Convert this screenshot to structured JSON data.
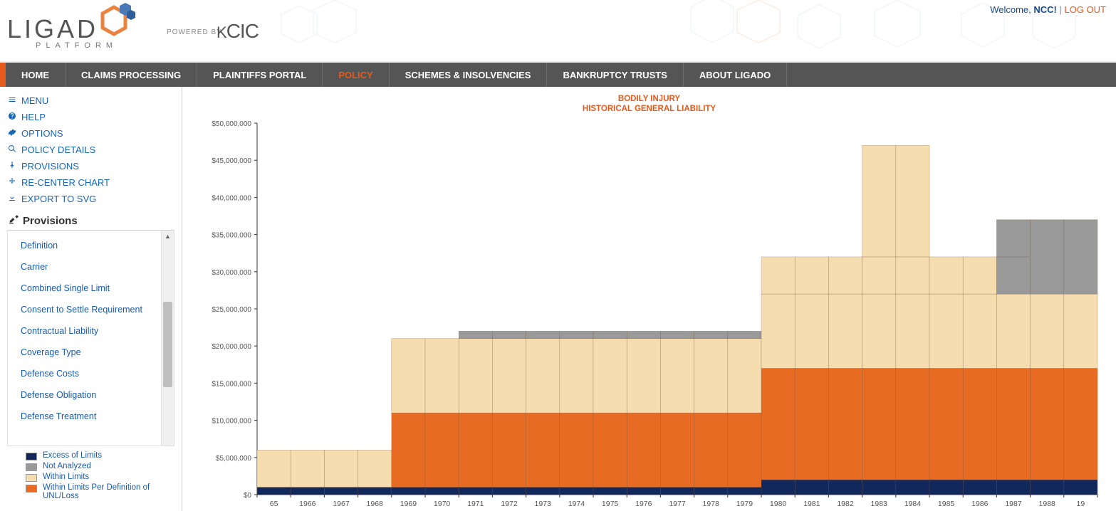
{
  "header": {
    "brand_main": "LIGAD",
    "brand_sub": "PLATFORM",
    "powered_by": "POWERED BY",
    "powered_brand": "KCIC",
    "welcome_prefix": "Welcome, ",
    "welcome_user": "NCC!",
    "logout": "LOG OUT"
  },
  "nav": {
    "items": [
      {
        "label": "HOME",
        "active": false
      },
      {
        "label": "CLAIMS PROCESSING",
        "active": false
      },
      {
        "label": "PLAINTIFFS PORTAL",
        "active": false
      },
      {
        "label": "POLICY",
        "active": true
      },
      {
        "label": "SCHEMES & INSOLVENCIES",
        "active": false
      },
      {
        "label": "BANKRUPTCY TRUSTS",
        "active": false
      },
      {
        "label": "ABOUT LIGADO",
        "active": false
      }
    ]
  },
  "sidebar": {
    "tools": [
      {
        "icon": "menu",
        "label": "MENU"
      },
      {
        "icon": "help",
        "label": "HELP"
      },
      {
        "icon": "options",
        "label": "OPTIONS"
      },
      {
        "icon": "search",
        "label": "POLICY DETAILS"
      },
      {
        "icon": "pin",
        "label": "PROVISIONS"
      },
      {
        "icon": "move",
        "label": "RE-CENTER CHART"
      },
      {
        "icon": "download",
        "label": "EXPORT TO SVG"
      }
    ],
    "panel_title": "Provisions",
    "provisions": [
      "Definition",
      "Carrier",
      "Combined Single Limit",
      "Consent to Settle Requirement",
      "Contractual Liability",
      "Coverage Type",
      "Defense Costs",
      "Defense Obligation",
      "Defense Treatment"
    ],
    "legend": [
      {
        "color": "#12275c",
        "label": "Excess of Limits"
      },
      {
        "color": "#9a9a9a",
        "label": "Not Analyzed"
      },
      {
        "color": "#f6ddb0",
        "label": "Within Limits"
      },
      {
        "color": "#e86b24",
        "label": "Within Limits Per Definition of UNL/Loss"
      }
    ]
  },
  "chart": {
    "title_line1": "BODILY INJURY",
    "title_line2": "HISTORICAL GENERAL LIABILITY"
  },
  "chart_data": {
    "type": "bar",
    "xlabel": "",
    "ylabel": "",
    "ylim": [
      0,
      50000000
    ],
    "yticks": [
      0,
      5000000,
      10000000,
      15000000,
      20000000,
      25000000,
      30000000,
      35000000,
      40000000,
      45000000,
      50000000
    ],
    "ytick_labels": [
      "$0",
      "$5,000,000",
      "$10,000,000",
      "$15,000,000",
      "$20,000,000",
      "$25,000,000",
      "$30,000,000",
      "$35,000,000",
      "$40,000,000",
      "$45,000,000",
      "$50,000,000"
    ],
    "categories": [
      "65",
      "1966",
      "1967",
      "1968",
      "1969",
      "1970",
      "1971",
      "1972",
      "1973",
      "1974",
      "1975",
      "1976",
      "1977",
      "1978",
      "1979",
      "1980",
      "1981",
      "1982",
      "1983",
      "1984",
      "1985",
      "1986",
      "1987",
      "1988",
      "19"
    ],
    "series_colors": {
      "excess_of_limits": "#12275c",
      "within_limits_per_def": "#e86b24",
      "within_limits": "#f6ddb0",
      "not_analyzed": "#9a9a9a"
    },
    "stacks": [
      {
        "year": "65",
        "segments": [
          {
            "s": "excess_of_limits",
            "v": 1000000
          },
          {
            "s": "within_limits",
            "v": 5000000
          }
        ]
      },
      {
        "year": "1966",
        "segments": [
          {
            "s": "excess_of_limits",
            "v": 1000000
          },
          {
            "s": "within_limits",
            "v": 5000000
          }
        ]
      },
      {
        "year": "1967",
        "segments": [
          {
            "s": "excess_of_limits",
            "v": 1000000
          },
          {
            "s": "within_limits",
            "v": 5000000
          }
        ]
      },
      {
        "year": "1968",
        "segments": [
          {
            "s": "excess_of_limits",
            "v": 1000000
          },
          {
            "s": "within_limits",
            "v": 5000000
          }
        ]
      },
      {
        "year": "1969",
        "segments": [
          {
            "s": "excess_of_limits",
            "v": 1000000
          },
          {
            "s": "within_limits_per_def",
            "v": 10000000
          },
          {
            "s": "within_limits",
            "v": 10000000
          }
        ]
      },
      {
        "year": "1970",
        "segments": [
          {
            "s": "excess_of_limits",
            "v": 1000000
          },
          {
            "s": "within_limits_per_def",
            "v": 10000000
          },
          {
            "s": "within_limits",
            "v": 10000000
          }
        ]
      },
      {
        "year": "1971",
        "segments": [
          {
            "s": "excess_of_limits",
            "v": 1000000
          },
          {
            "s": "within_limits_per_def",
            "v": 10000000
          },
          {
            "s": "within_limits",
            "v": 10000000
          },
          {
            "s": "not_analyzed",
            "v": 1000000
          }
        ]
      },
      {
        "year": "1972",
        "segments": [
          {
            "s": "excess_of_limits",
            "v": 1000000
          },
          {
            "s": "within_limits_per_def",
            "v": 10000000
          },
          {
            "s": "within_limits",
            "v": 10000000
          },
          {
            "s": "not_analyzed",
            "v": 1000000
          }
        ]
      },
      {
        "year": "1973",
        "segments": [
          {
            "s": "excess_of_limits",
            "v": 1000000
          },
          {
            "s": "within_limits_per_def",
            "v": 10000000
          },
          {
            "s": "within_limits",
            "v": 10000000
          },
          {
            "s": "not_analyzed",
            "v": 1000000
          }
        ]
      },
      {
        "year": "1974",
        "segments": [
          {
            "s": "excess_of_limits",
            "v": 1000000
          },
          {
            "s": "within_limits_per_def",
            "v": 10000000
          },
          {
            "s": "within_limits",
            "v": 10000000
          },
          {
            "s": "not_analyzed",
            "v": 1000000
          }
        ]
      },
      {
        "year": "1975",
        "segments": [
          {
            "s": "excess_of_limits",
            "v": 1000000
          },
          {
            "s": "within_limits_per_def",
            "v": 10000000
          },
          {
            "s": "within_limits",
            "v": 10000000
          },
          {
            "s": "not_analyzed",
            "v": 1000000
          }
        ]
      },
      {
        "year": "1976",
        "segments": [
          {
            "s": "excess_of_limits",
            "v": 1000000
          },
          {
            "s": "within_limits_per_def",
            "v": 10000000
          },
          {
            "s": "within_limits",
            "v": 10000000
          },
          {
            "s": "not_analyzed",
            "v": 1000000
          }
        ]
      },
      {
        "year": "1977",
        "segments": [
          {
            "s": "excess_of_limits",
            "v": 1000000
          },
          {
            "s": "within_limits_per_def",
            "v": 10000000
          },
          {
            "s": "within_limits",
            "v": 10000000
          },
          {
            "s": "not_analyzed",
            "v": 1000000
          }
        ]
      },
      {
        "year": "1978",
        "segments": [
          {
            "s": "excess_of_limits",
            "v": 1000000
          },
          {
            "s": "within_limits_per_def",
            "v": 10000000
          },
          {
            "s": "within_limits",
            "v": 10000000
          },
          {
            "s": "not_analyzed",
            "v": 1000000
          }
        ]
      },
      {
        "year": "1979",
        "segments": [
          {
            "s": "excess_of_limits",
            "v": 1000000
          },
          {
            "s": "within_limits_per_def",
            "v": 10000000
          },
          {
            "s": "within_limits",
            "v": 10000000
          },
          {
            "s": "not_analyzed",
            "v": 1000000
          }
        ]
      },
      {
        "year": "1980",
        "segments": [
          {
            "s": "excess_of_limits",
            "v": 2000000
          },
          {
            "s": "within_limits_per_def",
            "v": 15000000
          },
          {
            "s": "within_limits",
            "v": 10000000
          },
          {
            "s": "within_limits",
            "v": 5000000
          }
        ]
      },
      {
        "year": "1981",
        "segments": [
          {
            "s": "excess_of_limits",
            "v": 2000000
          },
          {
            "s": "within_limits_per_def",
            "v": 15000000
          },
          {
            "s": "within_limits",
            "v": 10000000
          },
          {
            "s": "within_limits",
            "v": 5000000
          }
        ]
      },
      {
        "year": "1982",
        "segments": [
          {
            "s": "excess_of_limits",
            "v": 2000000
          },
          {
            "s": "within_limits_per_def",
            "v": 15000000
          },
          {
            "s": "within_limits",
            "v": 10000000
          },
          {
            "s": "within_limits",
            "v": 5000000
          }
        ]
      },
      {
        "year": "1983",
        "segments": [
          {
            "s": "excess_of_limits",
            "v": 2000000
          },
          {
            "s": "within_limits_per_def",
            "v": 15000000
          },
          {
            "s": "within_limits",
            "v": 10000000
          },
          {
            "s": "within_limits",
            "v": 5000000
          },
          {
            "s": "within_limits",
            "v": 15000000
          }
        ]
      },
      {
        "year": "1984",
        "segments": [
          {
            "s": "excess_of_limits",
            "v": 2000000
          },
          {
            "s": "within_limits_per_def",
            "v": 15000000
          },
          {
            "s": "within_limits",
            "v": 10000000
          },
          {
            "s": "within_limits",
            "v": 5000000
          },
          {
            "s": "within_limits",
            "v": 15000000
          }
        ]
      },
      {
        "year": "1985",
        "segments": [
          {
            "s": "excess_of_limits",
            "v": 2000000
          },
          {
            "s": "within_limits_per_def",
            "v": 15000000
          },
          {
            "s": "within_limits",
            "v": 10000000
          },
          {
            "s": "within_limits",
            "v": 5000000
          }
        ]
      },
      {
        "year": "1986",
        "segments": [
          {
            "s": "excess_of_limits",
            "v": 2000000
          },
          {
            "s": "within_limits_per_def",
            "v": 15000000
          },
          {
            "s": "within_limits",
            "v": 10000000
          },
          {
            "s": "within_limits",
            "v": 5000000
          }
        ]
      },
      {
        "year": "1987",
        "segments": [
          {
            "s": "excess_of_limits",
            "v": 2000000
          },
          {
            "s": "within_limits_per_def",
            "v": 15000000
          },
          {
            "s": "within_limits",
            "v": 10000000
          },
          {
            "s": "not_analyzed",
            "v": 5000000
          },
          {
            "s": "not_analyzed",
            "v": 5000000
          }
        ]
      },
      {
        "year": "1988",
        "segments": [
          {
            "s": "excess_of_limits",
            "v": 2000000
          },
          {
            "s": "within_limits_per_def",
            "v": 15000000
          },
          {
            "s": "within_limits",
            "v": 10000000
          },
          {
            "s": "not_analyzed",
            "v": 10000000
          }
        ]
      },
      {
        "year": "19",
        "segments": [
          {
            "s": "excess_of_limits",
            "v": 2000000
          },
          {
            "s": "within_limits_per_def",
            "v": 15000000
          },
          {
            "s": "within_limits",
            "v": 10000000
          },
          {
            "s": "not_analyzed",
            "v": 10000000
          }
        ]
      }
    ]
  }
}
